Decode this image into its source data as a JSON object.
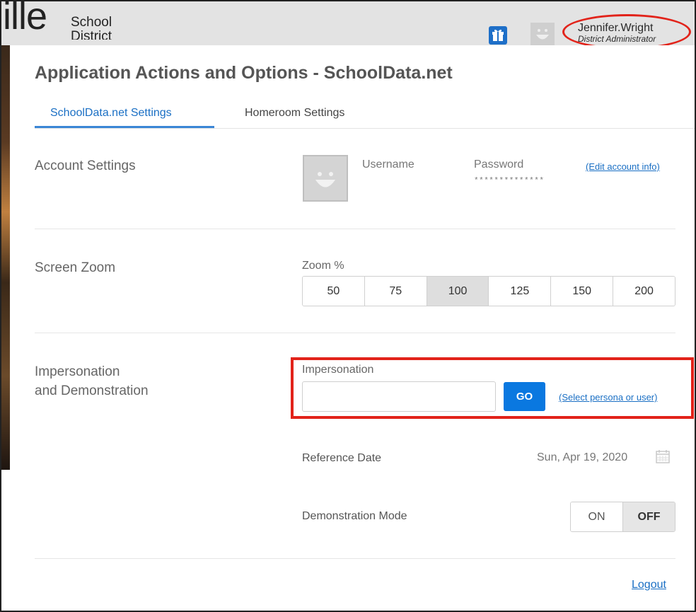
{
  "header": {
    "logo_partial": "ille",
    "logo_line1": "School",
    "logo_line2": "District",
    "user_name": "Jennifer.Wright",
    "user_role": "District Administrator"
  },
  "dialog": {
    "title": "Application Actions and Options - SchoolData.net",
    "tabs": [
      {
        "label": "SchoolData.net Settings",
        "active": true
      },
      {
        "label": "Homeroom Settings",
        "active": false
      }
    ]
  },
  "account": {
    "section_label": "Account Settings",
    "username_label": "Username",
    "password_label": "Password",
    "password_mask": "**************",
    "edit_link": "(Edit account info)"
  },
  "zoom": {
    "section_label": "Screen Zoom",
    "label": "Zoom %",
    "options": [
      "50",
      "75",
      "100",
      "125",
      "150",
      "200"
    ],
    "selected": "100"
  },
  "impersonation": {
    "section_label_line1": "Impersonation",
    "section_label_line2": "and Demonstration",
    "field_label": "Impersonation",
    "input_value": "",
    "go_label": "GO",
    "select_link": "(Select persona or user)"
  },
  "reference_date": {
    "label": "Reference Date",
    "value": "Sun, Apr 19, 2020"
  },
  "demo_mode": {
    "label": "Demonstration Mode",
    "on_label": "ON",
    "off_label": "OFF",
    "selected": "OFF"
  },
  "footer": {
    "logout_label": "Logout"
  },
  "colors": {
    "accent": "#1a6fc4",
    "go_button": "#0a78e0",
    "annotation": "#e2231a"
  }
}
